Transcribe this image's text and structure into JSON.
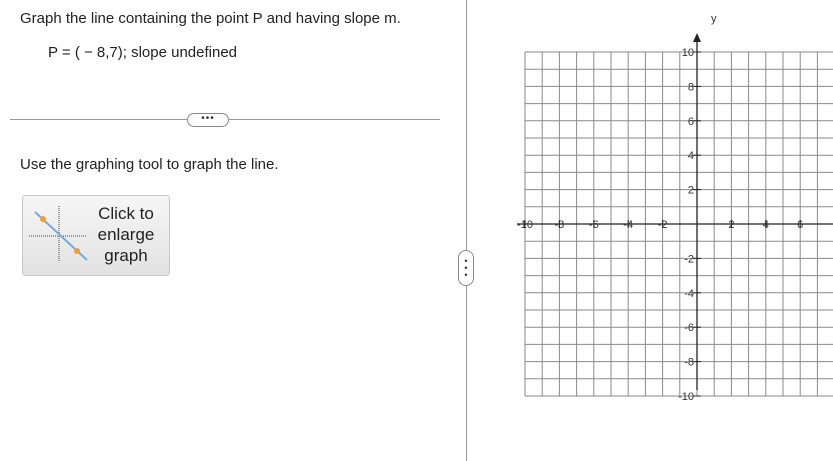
{
  "question": {
    "text": "Graph the line containing the point P and having slope m.",
    "given": "P = ( − 8,7); slope undefined"
  },
  "more_button": {
    "label": "•••"
  },
  "instruction": "Use the graphing tool to graph the line.",
  "enlarge_button": {
    "line1": "Click to",
    "line2": "enlarge",
    "line3": "graph"
  },
  "graph": {
    "y_axis_label": "y",
    "x_range": [
      -10,
      8
    ],
    "y_range": [
      -10,
      10
    ],
    "x_tick_labels": [
      "-10",
      "-8",
      "-6",
      "-4",
      "-2",
      "2",
      "4",
      "6"
    ],
    "y_tick_labels": [
      "10",
      "8",
      "6",
      "4",
      "2",
      "-2",
      "-4",
      "-6",
      "-8",
      "-10"
    ],
    "grid": true
  }
}
